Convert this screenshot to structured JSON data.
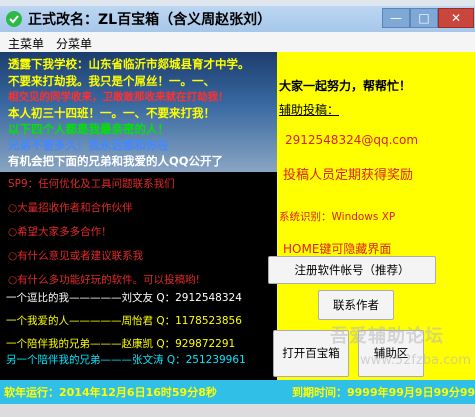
{
  "window": {
    "title": "正式改名：ZL百宝箱（含义周赵张刘）",
    "min": "—",
    "max": "□",
    "close": "✕"
  },
  "menu": [
    "主菜单",
    "分菜单"
  ],
  "left": {
    "lines": [
      {
        "text": "透露下我学校：山东省临沂市郯城县育才中学。",
        "color": "#ffff00"
      },
      {
        "text": "不要来打劫我。我只是个屌丝！一。一、",
        "color": "#ffff00"
      },
      {
        "text": "相交见的同学收来，卫敢敢那收来就在打劫我！",
        "color": "#ff3030"
      },
      {
        "text": "本人初三十四班！一。一、不要来打我！",
        "color": "#ffff00"
      },
      {
        "text": "以下四个人都是我最亲密的人！",
        "color": "#00e400"
      },
      {
        "text": "兄弟不管多久！我永远都和你在",
        "color": "#4488ff"
      },
      {
        "text": "有机会把下面的兄弟和我爱的人QQ公开了",
        "color": "#ffffff"
      }
    ],
    "radio_items": [
      "SP9：任何优化及工具问题联系我们",
      "○大量招收作者和合作伙伴",
      "○希望大家多多合作！",
      "○有什么意见或者建议联系我",
      "○有什么多功能好玩的软件。可以投稿哟!"
    ],
    "friends": [
      {
        "text": "一个逗比的我—————刘文友 Q：2912548324",
        "color": "#ffffff"
      },
      {
        "text": "一个我爱的人—————周怡君 Q：1178523856",
        "color": "#ffff00"
      },
      {
        "text": "一个陪伴我的兄弟———赵康凯 Q：929872291",
        "color": "#ffff00"
      },
      {
        "text": "另一个陪伴我的兄弟———张文涛 Q：251239961",
        "color": "#00e6ff"
      }
    ]
  },
  "right": {
    "slogan": "大家一起努力，帮帮忙！",
    "contribute_label": "辅助投稿：",
    "email": "2912548324@qq.com",
    "reward": "投稿人员定期获得奖励",
    "system": "系统识别：Windows XP",
    "hotkey": "HOME键可隐藏界面"
  },
  "buttons": {
    "register": "注册软件帐号（推荐）",
    "contact": "联系作者",
    "open": "打开百宝箱",
    "assist": "辅助区"
  },
  "watermark": {
    "main": "吾爱辅助论坛",
    "url": "www.52fzba.com"
  },
  "status": {
    "running": "软年运行：2014年12月6日16时59分8秒",
    "expire": "到期时间：9999年99月9日99分99"
  },
  "colors": {
    "status_bar": "#30bfe6",
    "right_bg": "#ffff00",
    "left_bg": "#000000"
  }
}
